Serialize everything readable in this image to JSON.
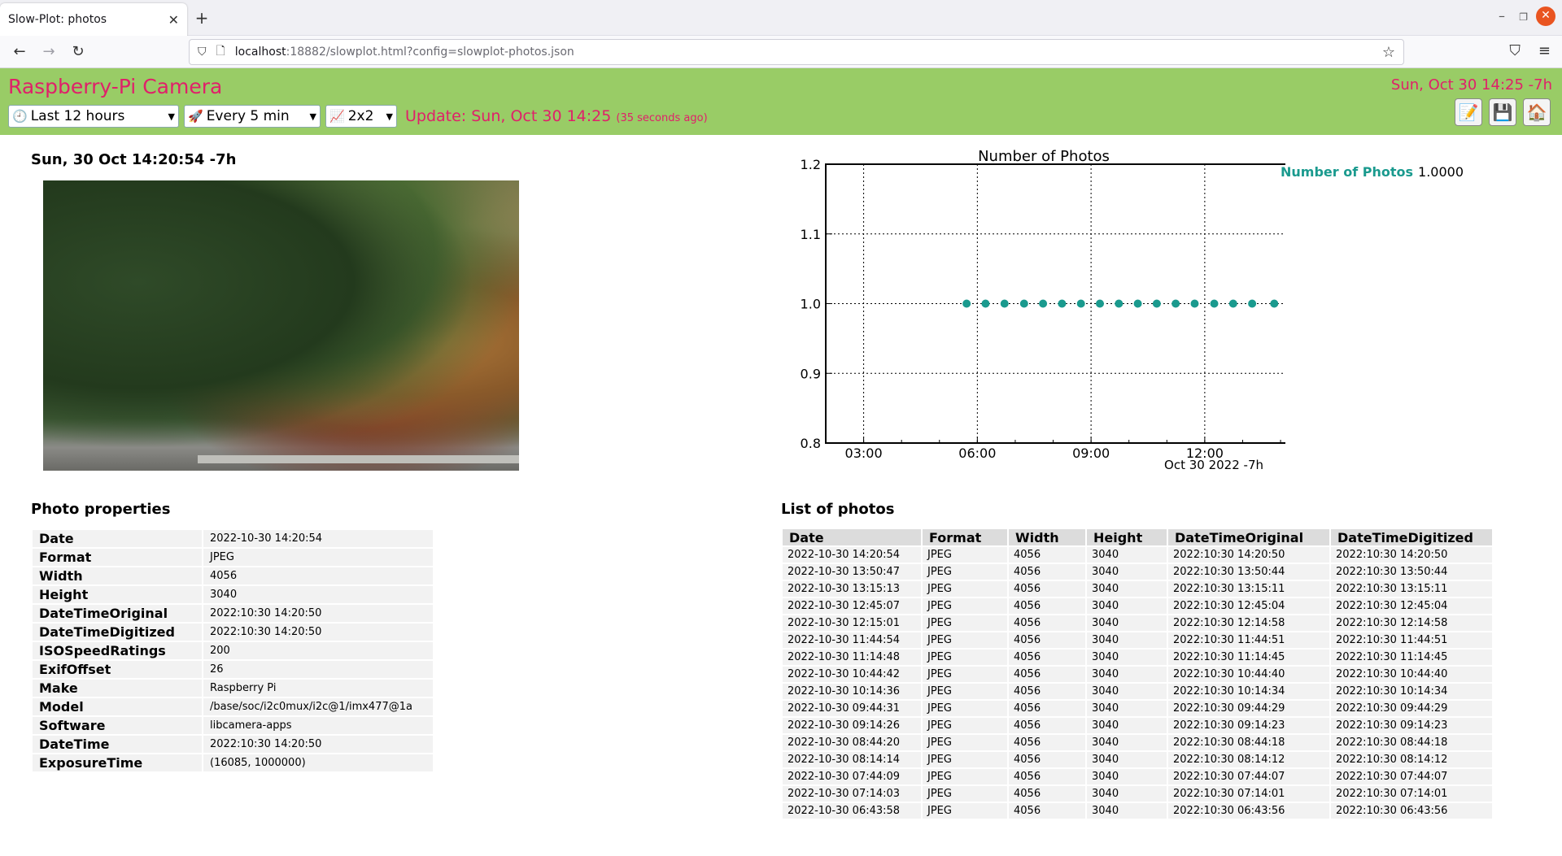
{
  "browser": {
    "tab_title": "Slow-Plot: photos",
    "url_host": "localhost",
    "url_rest": ":18882/slowplot.html?config=slowplot-photos.json"
  },
  "header": {
    "title": "Raspberry-Pi Camera",
    "time": "Sun, Oct 30 14:25 -7h",
    "range_select": "Last 12 hours",
    "interval_select": "Every 5 min",
    "grid_select": "2x2",
    "update": "Update: Sun, Oct 30 14:25",
    "update_ago": "(35 seconds ago)"
  },
  "photo_panel": {
    "timestamp": "Sun, 30 Oct 14:20:54 -7h"
  },
  "properties": {
    "title": "Photo properties",
    "rows": [
      {
        "key": "Date",
        "value": "2022-10-30 14:20:54"
      },
      {
        "key": "Format",
        "value": "JPEG"
      },
      {
        "key": "Width",
        "value": "4056"
      },
      {
        "key": "Height",
        "value": "3040"
      },
      {
        "key": "DateTimeOriginal",
        "value": "2022:10:30 14:20:50"
      },
      {
        "key": "DateTimeDigitized",
        "value": "2022:10:30 14:20:50"
      },
      {
        "key": "ISOSpeedRatings",
        "value": "200"
      },
      {
        "key": "ExifOffset",
        "value": "26"
      },
      {
        "key": "Make",
        "value": "Raspberry Pi"
      },
      {
        "key": "Model",
        "value": "/base/soc/i2c0mux/i2c@1/imx477@1a"
      },
      {
        "key": "Software",
        "value": "libcamera-apps"
      },
      {
        "key": "DateTime",
        "value": "2022:10:30 14:20:50"
      },
      {
        "key": "ExposureTime",
        "value": "(16085, 1000000)"
      }
    ]
  },
  "chart_data": {
    "type": "scatter",
    "title": "Number of Photos",
    "xlabel": "",
    "ylabel": "",
    "x_ticks": [
      "03:00",
      "06:00",
      "09:00",
      "12:00"
    ],
    "x_corner_label": "Oct 30 2022 -7h",
    "xlim": [
      "2022-10-30 02:00",
      "2022-10-30 14:45"
    ],
    "ylim": [
      0.8,
      1.2
    ],
    "y_ticks": [
      "0.8",
      "0.9",
      "1.0",
      "1.1",
      "1.2"
    ],
    "grid": true,
    "series": [
      {
        "name": "Number of Photos",
        "color": "#1a9a8e",
        "x": [
          "2022-10-30 05:43",
          "2022-10-30 06:13",
          "2022-10-30 06:43",
          "2022-10-30 07:14",
          "2022-10-30 07:44",
          "2022-10-30 08:14",
          "2022-10-30 08:44",
          "2022-10-30 09:14",
          "2022-10-30 09:44",
          "2022-10-30 10:14",
          "2022-10-30 10:44",
          "2022-10-30 11:14",
          "2022-10-30 11:44",
          "2022-10-30 12:15",
          "2022-10-30 12:45",
          "2022-10-30 13:15",
          "2022-10-30 13:50",
          "2022-10-30 14:20"
        ],
        "y": [
          1,
          1,
          1,
          1,
          1,
          1,
          1,
          1,
          1,
          1,
          1,
          1,
          1,
          1,
          1,
          1,
          1,
          1
        ]
      }
    ],
    "legend_value": "1.0000"
  },
  "photo_list": {
    "title": "List of photos",
    "columns": [
      "Date",
      "Format",
      "Width",
      "Height",
      "DateTimeOriginal",
      "DateTimeDigitized"
    ],
    "rows": [
      [
        "2022-10-30 14:20:54",
        "JPEG",
        "4056",
        "3040",
        "2022:10:30 14:20:50",
        "2022:10:30 14:20:50"
      ],
      [
        "2022-10-30 13:50:47",
        "JPEG",
        "4056",
        "3040",
        "2022:10:30 13:50:44",
        "2022:10:30 13:50:44"
      ],
      [
        "2022-10-30 13:15:13",
        "JPEG",
        "4056",
        "3040",
        "2022:10:30 13:15:11",
        "2022:10:30 13:15:11"
      ],
      [
        "2022-10-30 12:45:07",
        "JPEG",
        "4056",
        "3040",
        "2022:10:30 12:45:04",
        "2022:10:30 12:45:04"
      ],
      [
        "2022-10-30 12:15:01",
        "JPEG",
        "4056",
        "3040",
        "2022:10:30 12:14:58",
        "2022:10:30 12:14:58"
      ],
      [
        "2022-10-30 11:44:54",
        "JPEG",
        "4056",
        "3040",
        "2022:10:30 11:44:51",
        "2022:10:30 11:44:51"
      ],
      [
        "2022-10-30 11:14:48",
        "JPEG",
        "4056",
        "3040",
        "2022:10:30 11:14:45",
        "2022:10:30 11:14:45"
      ],
      [
        "2022-10-30 10:44:42",
        "JPEG",
        "4056",
        "3040",
        "2022:10:30 10:44:40",
        "2022:10:30 10:44:40"
      ],
      [
        "2022-10-30 10:14:36",
        "JPEG",
        "4056",
        "3040",
        "2022:10:30 10:14:34",
        "2022:10:30 10:14:34"
      ],
      [
        "2022-10-30 09:44:31",
        "JPEG",
        "4056",
        "3040",
        "2022:10:30 09:44:29",
        "2022:10:30 09:44:29"
      ],
      [
        "2022-10-30 09:14:26",
        "JPEG",
        "4056",
        "3040",
        "2022:10:30 09:14:23",
        "2022:10:30 09:14:23"
      ],
      [
        "2022-10-30 08:44:20",
        "JPEG",
        "4056",
        "3040",
        "2022:10:30 08:44:18",
        "2022:10:30 08:44:18"
      ],
      [
        "2022-10-30 08:14:14",
        "JPEG",
        "4056",
        "3040",
        "2022:10:30 08:14:12",
        "2022:10:30 08:14:12"
      ],
      [
        "2022-10-30 07:44:09",
        "JPEG",
        "4056",
        "3040",
        "2022:10:30 07:44:07",
        "2022:10:30 07:44:07"
      ],
      [
        "2022-10-30 07:14:03",
        "JPEG",
        "4056",
        "3040",
        "2022:10:30 07:14:01",
        "2022:10:30 07:14:01"
      ],
      [
        "2022-10-30 06:43:58",
        "JPEG",
        "4056",
        "3040",
        "2022:10:30 06:43:56",
        "2022:10:30 06:43:56"
      ]
    ]
  }
}
